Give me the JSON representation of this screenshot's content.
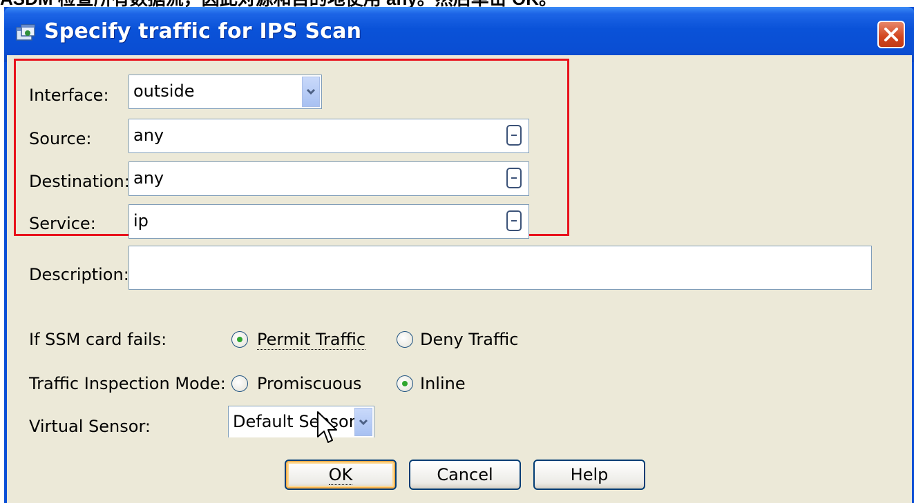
{
  "caption": {
    "text": "ASDM 检查所有数据流，因此对源和目的地使用 any。然后单击 OK。"
  },
  "window": {
    "title": "Specify traffic for IPS Scan",
    "icon": "app-window-icon",
    "close_icon": "close-icon"
  },
  "form": {
    "interface": {
      "label": "Interface:",
      "value": "outside"
    },
    "source": {
      "label": "Source:",
      "value": "any"
    },
    "destination": {
      "label": "Destination:",
      "value": "any"
    },
    "service": {
      "label": "Service:",
      "value": "ip"
    },
    "description": {
      "label": "Description:",
      "value": ""
    },
    "ssm_fail": {
      "label": "If SSM card fails:",
      "options": [
        {
          "label": "Permit Traffic",
          "selected": true
        },
        {
          "label": "Deny Traffic",
          "selected": false
        }
      ]
    },
    "inspection_mode": {
      "label": "Traffic Inspection Mode:",
      "options": [
        {
          "label": "Promiscuous",
          "selected": false
        },
        {
          "label": "Inline",
          "selected": true
        }
      ]
    },
    "virtual_sensor": {
      "label": "Virtual Sensor:",
      "value": "Default Sensor"
    }
  },
  "buttons": {
    "ok": "OK",
    "cancel": "Cancel",
    "help": "Help"
  },
  "colors": {
    "titlebar": "#0a52d8",
    "dialog_bg": "#ece9d8",
    "highlight_box": "#e8121c"
  }
}
